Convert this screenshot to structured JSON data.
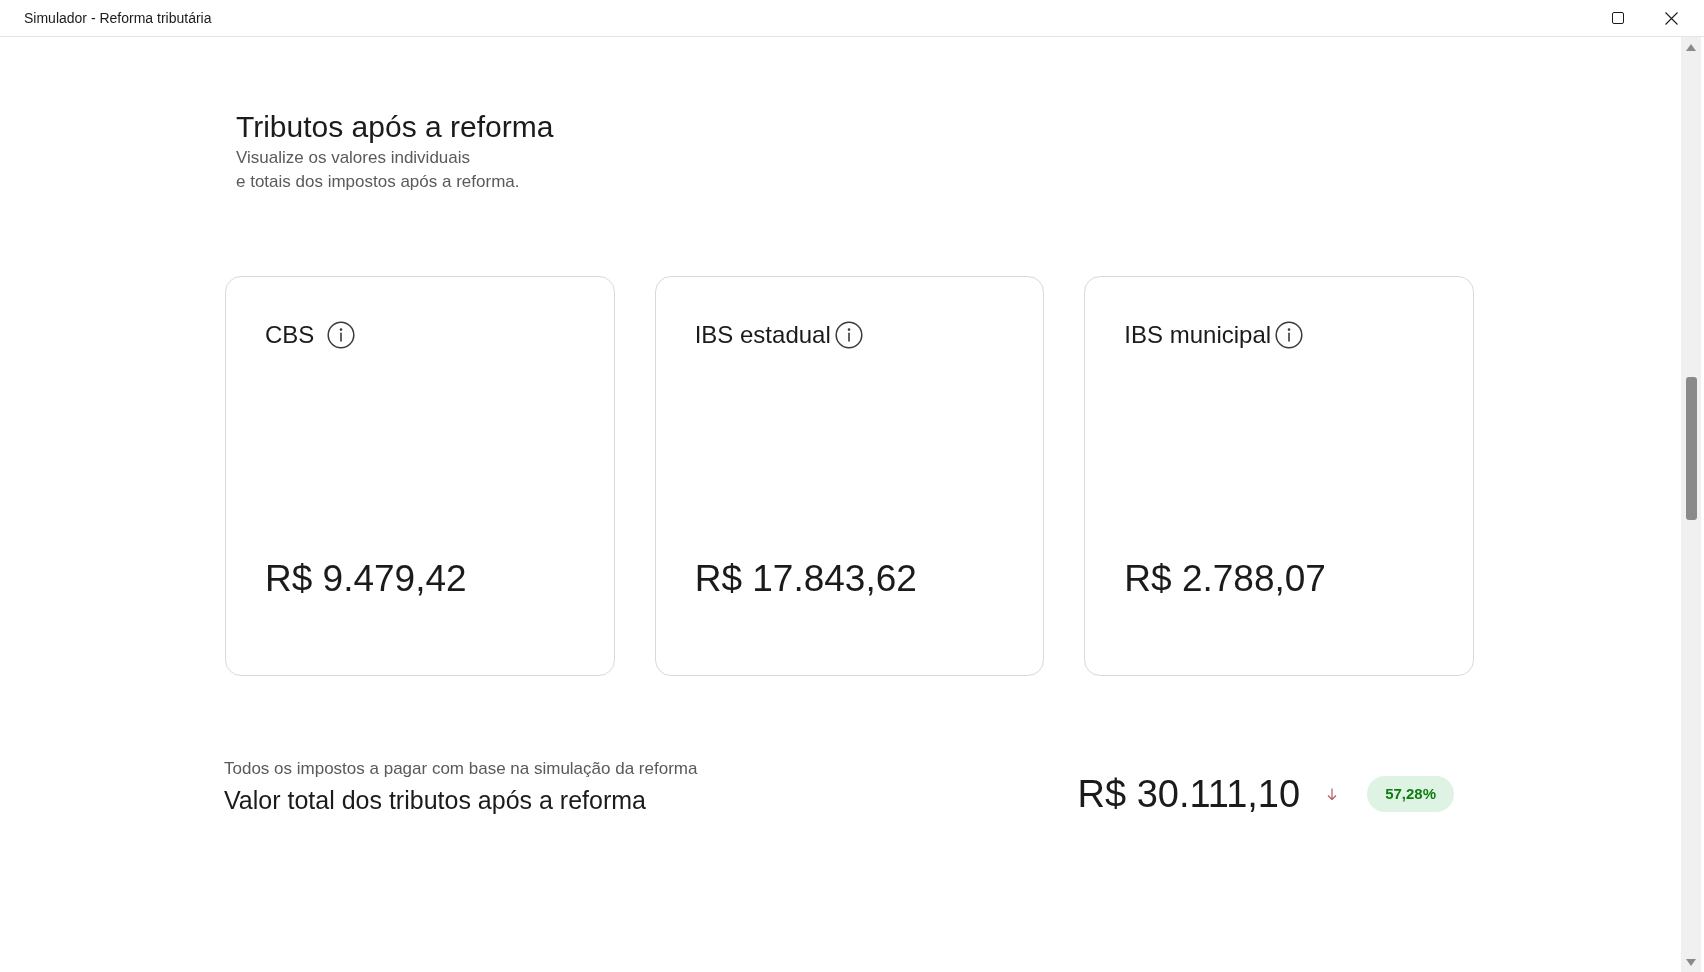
{
  "window": {
    "title": "Simulador - Reforma tributária"
  },
  "header": {
    "title": "Tributos após a reforma",
    "subtitle": "Visualize os valores individuais\ne totais dos impostos após a reforma."
  },
  "cards": [
    {
      "label": "CBS",
      "value": "R$ 9.479,42"
    },
    {
      "label": "IBS estadual",
      "value": "R$ 17.843,62"
    },
    {
      "label": "IBS municipal",
      "value": "R$ 2.788,07"
    }
  ],
  "total": {
    "caption": "Todos os impostos a pagar com base na simulação da reforma",
    "title": "Valor total dos tributos após a reforma",
    "value": "R$ 30.111,10",
    "decrease": true,
    "badge": "57,28%"
  }
}
